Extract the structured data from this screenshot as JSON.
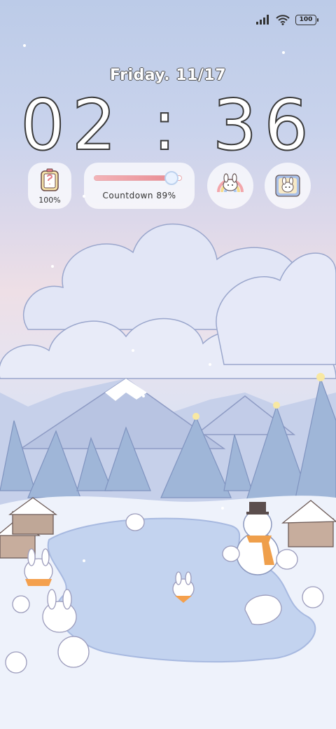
{
  "status_bar": {
    "signal_icon": "signal-icon",
    "wifi_icon": "wifi-icon",
    "battery_level": "100"
  },
  "lockscreen": {
    "date": "Friday. 11/17",
    "time": "02 : 36"
  },
  "widgets": {
    "battery": {
      "label": "100%",
      "icon": "phone-battery-icon"
    },
    "countdown": {
      "label": "Countdown  89%",
      "progress": 0.89
    },
    "rainbow_bunny": {
      "icon": "bunny-rainbow-icon"
    },
    "photo": {
      "icon": "bunny-photo-icon"
    }
  }
}
